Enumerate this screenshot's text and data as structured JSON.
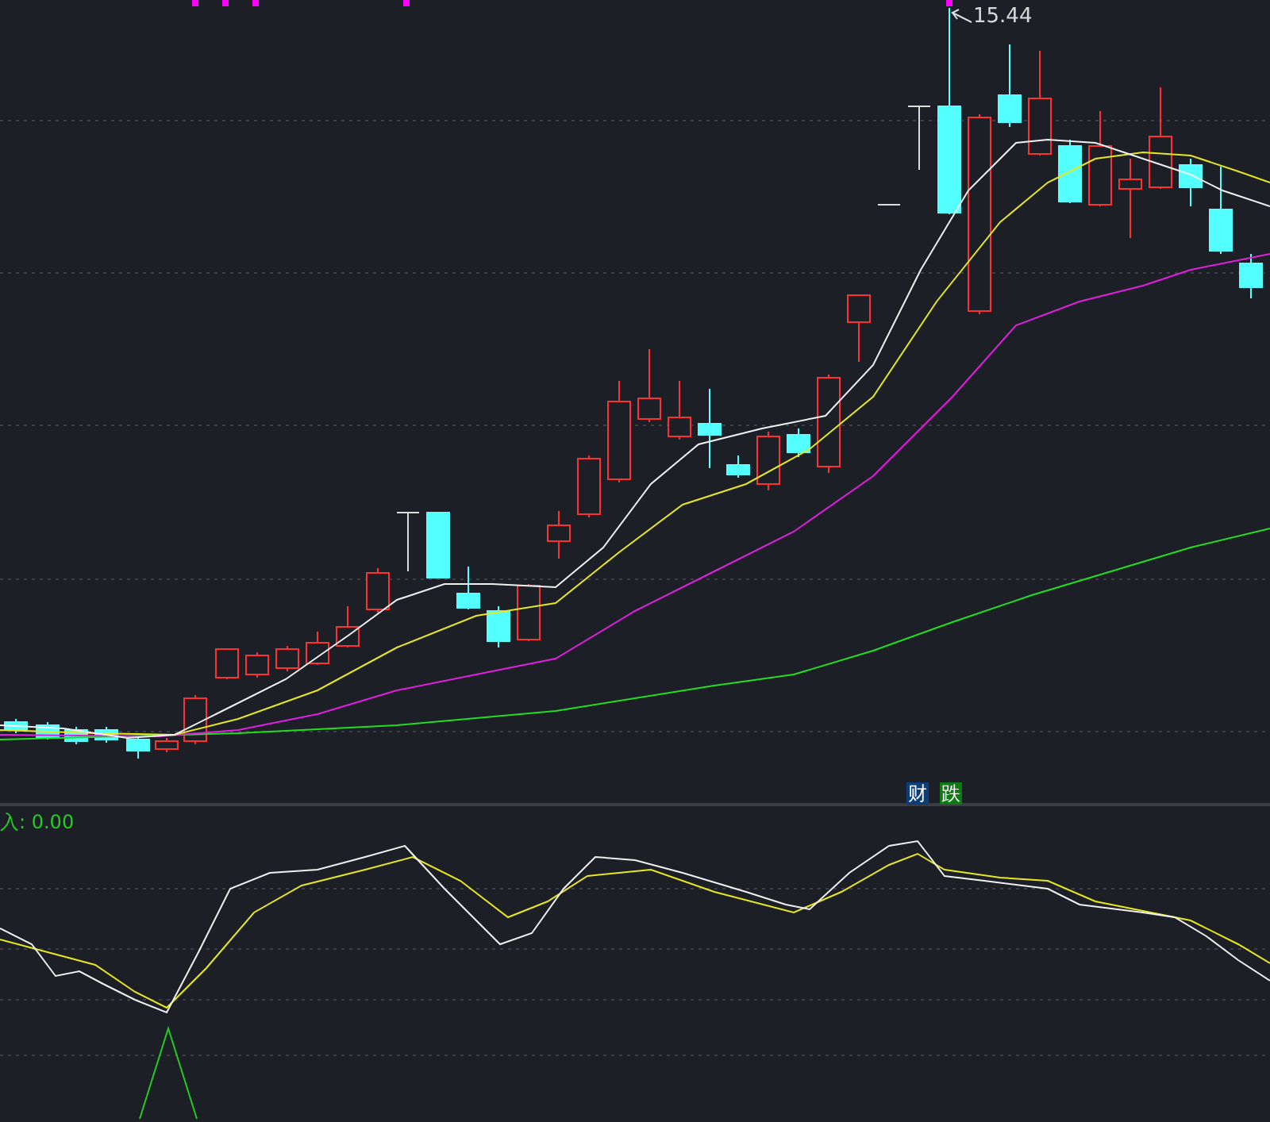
{
  "price_chart": {
    "high_label": "15.44",
    "signals": [
      {
        "label": "财",
        "color": "#0b3d7a"
      },
      {
        "label": "跌",
        "color": "#0f7a14"
      }
    ]
  },
  "indicator_panel": {
    "reading": "入: 0.00"
  }
}
